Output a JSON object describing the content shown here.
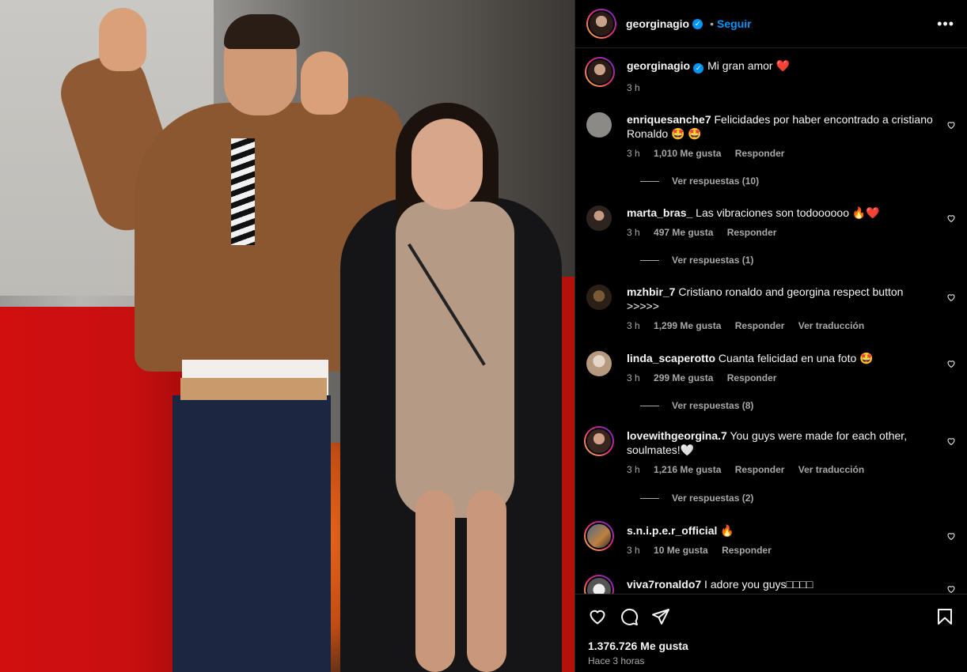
{
  "post": {
    "author": "georginagio",
    "follow_label": "Seguir",
    "more_label": "•••",
    "caption_text": "Mi gran amor",
    "caption_emoji": "❤️",
    "caption_time": "3 h"
  },
  "comments": [
    {
      "user": "enriquesanche7",
      "text": "Felicidades por haber encontrado a cristiano Ronaldo 🤩 🤩",
      "time": "3 h",
      "likes": "1,010 Me gusta",
      "reply": "Responder",
      "translate": "",
      "replies": "Ver respuestas (10)",
      "avatar_color": "#8c8a86"
    },
    {
      "user": "marta_bras_",
      "text": "Las vibraciones son todoooooo 🔥❤️",
      "time": "3 h",
      "likes": "497 Me gusta",
      "reply": "Responder",
      "translate": "",
      "replies": "Ver respuestas (1)",
      "avatar_color": "#5a4a40"
    },
    {
      "user": "mzhbir_7",
      "text": "Cristiano ronaldo and georgina respect button >>>>>",
      "time": "3 h",
      "likes": "1,299 Me gusta",
      "reply": "Responder",
      "translate": "Ver traducción",
      "replies": "",
      "avatar_color": "#4a3a2a"
    },
    {
      "user": "linda_scaperotto",
      "text": "Cuanta felicidad en una foto 🤩",
      "time": "3 h",
      "likes": "299 Me gusta",
      "reply": "Responder",
      "translate": "",
      "replies": "Ver respuestas (8)",
      "avatar_color": "#d8c8b8"
    },
    {
      "user": "lovewithgeorgina.7",
      "text": "You guys were made for each other, soulmates!🤍",
      "time": "3 h",
      "likes": "1,216 Me gusta",
      "reply": "Responder",
      "translate": "Ver traducción",
      "replies": "Ver respuestas (2)",
      "avatar_color": "#6a5048"
    },
    {
      "user": "s.n.i.p.e.r_official",
      "text": "🔥",
      "time": "3 h",
      "likes": "10 Me gusta",
      "reply": "Responder",
      "translate": "",
      "replies": "",
      "avatar_color": "#3a4a5a"
    },
    {
      "user": "viva7ronaldo7",
      "text": "I adore you guys□□□□",
      "time": "",
      "likes": "",
      "reply": "",
      "translate": "",
      "replies": "",
      "avatar_color": "#dcdcdc"
    }
  ],
  "footer": {
    "likes_count": "1.376.726 Me gusta",
    "time_ago": "Hace 3 horas"
  },
  "icons": {
    "like": "heart-icon",
    "comment": "comment-icon",
    "share": "share-icon",
    "save": "bookmark-icon",
    "verified": "verified-badge-icon"
  },
  "colors": {
    "accent": "#0095f6",
    "heart": "#ff3040",
    "background": "#000000",
    "muted": "#a8a8a8"
  }
}
